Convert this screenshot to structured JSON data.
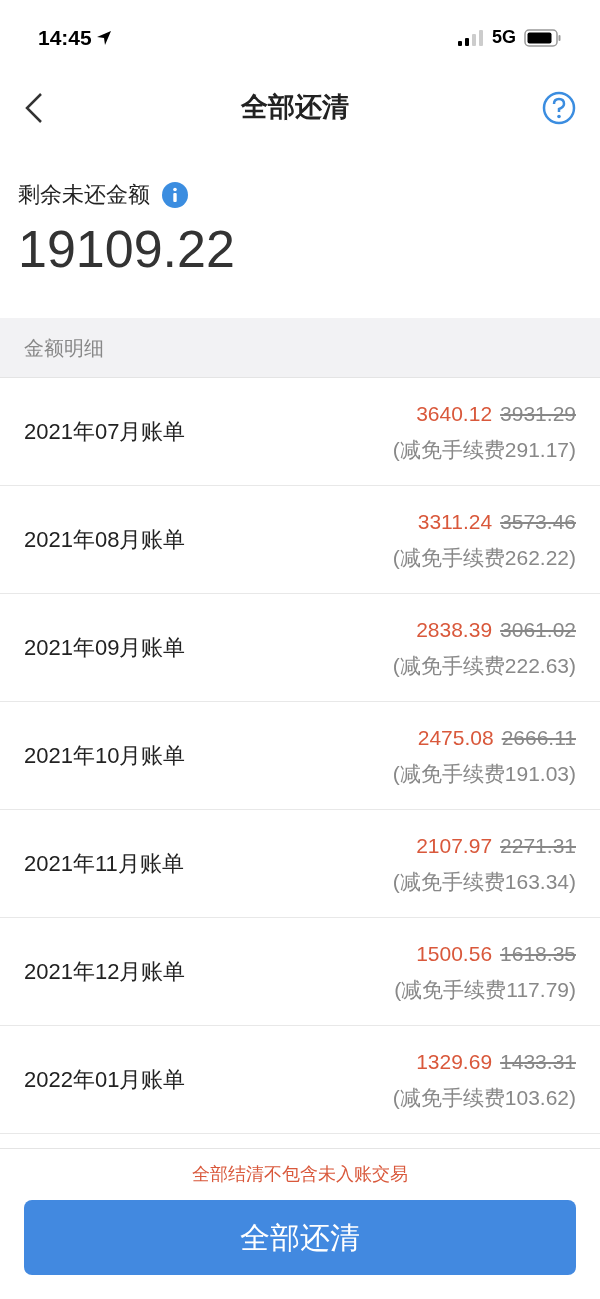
{
  "status_bar": {
    "time": "14:45",
    "network": "5G"
  },
  "nav": {
    "title": "全部还清"
  },
  "summary": {
    "label": "剩余未还金额",
    "amount": "19109.22"
  },
  "section": {
    "title": "金额明细"
  },
  "bills": [
    {
      "name": "2021年07月账单",
      "amount": "3640.12",
      "original": "3931.29",
      "waiver": "(减免手续费291.17)"
    },
    {
      "name": "2021年08月账单",
      "amount": "3311.24",
      "original": "3573.46",
      "waiver": "(减免手续费262.22)"
    },
    {
      "name": "2021年09月账单",
      "amount": "2838.39",
      "original": "3061.02",
      "waiver": "(减免手续费222.63)"
    },
    {
      "name": "2021年10月账单",
      "amount": "2475.08",
      "original": "2666.11",
      "waiver": "(减免手续费191.03)"
    },
    {
      "name": "2021年11月账单",
      "amount": "2107.97",
      "original": "2271.31",
      "waiver": "(减免手续费163.34)"
    },
    {
      "name": "2021年12月账单",
      "amount": "1500.56",
      "original": "1618.35",
      "waiver": "(减免手续费117.79)"
    },
    {
      "name": "2022年01月账单",
      "amount": "1329.69",
      "original": "1433.31",
      "waiver": "(减免手续费103.62)"
    }
  ],
  "footer": {
    "notice": "全部结清不包含未入账交易",
    "button": "全部还清"
  }
}
